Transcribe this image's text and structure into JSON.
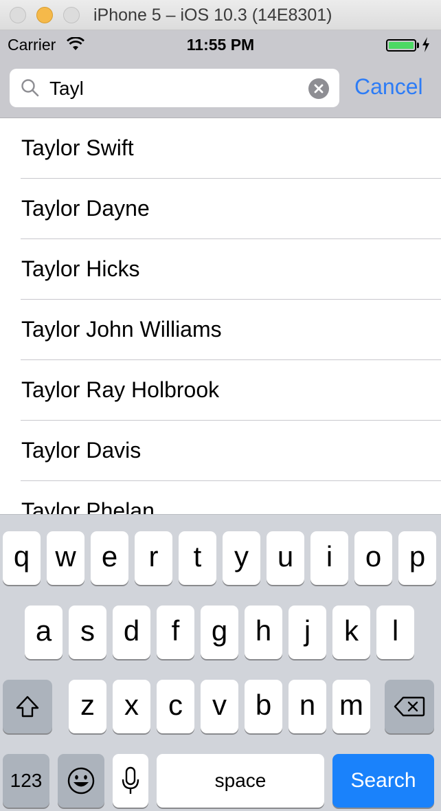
{
  "window": {
    "title": "iPhone 5 – iOS 10.3 (14E8301)"
  },
  "status_bar": {
    "carrier": "Carrier",
    "time": "11:55 PM",
    "battery_color": "#4cd964"
  },
  "search": {
    "query": "Tayl",
    "cancel_label": "Cancel",
    "accent_color": "#2d7cf6"
  },
  "results": [
    "Taylor Swift",
    "Taylor Dayne",
    "Taylor Hicks",
    "Taylor John Williams",
    "Taylor Ray Holbrook",
    "Taylor Davis",
    "Taylor Phelan"
  ],
  "keyboard": {
    "row1": [
      "q",
      "w",
      "e",
      "r",
      "t",
      "y",
      "u",
      "i",
      "o",
      "p"
    ],
    "row2": [
      "a",
      "s",
      "d",
      "f",
      "g",
      "h",
      "j",
      "k",
      "l"
    ],
    "row3": [
      "z",
      "x",
      "c",
      "v",
      "b",
      "n",
      "m"
    ],
    "numbers_label": "123",
    "space_label": "space",
    "search_label": "Search",
    "icons": {
      "shift": "shift-icon",
      "delete": "delete-icon",
      "emoji": "emoji-icon",
      "mic": "microphone-icon"
    }
  }
}
